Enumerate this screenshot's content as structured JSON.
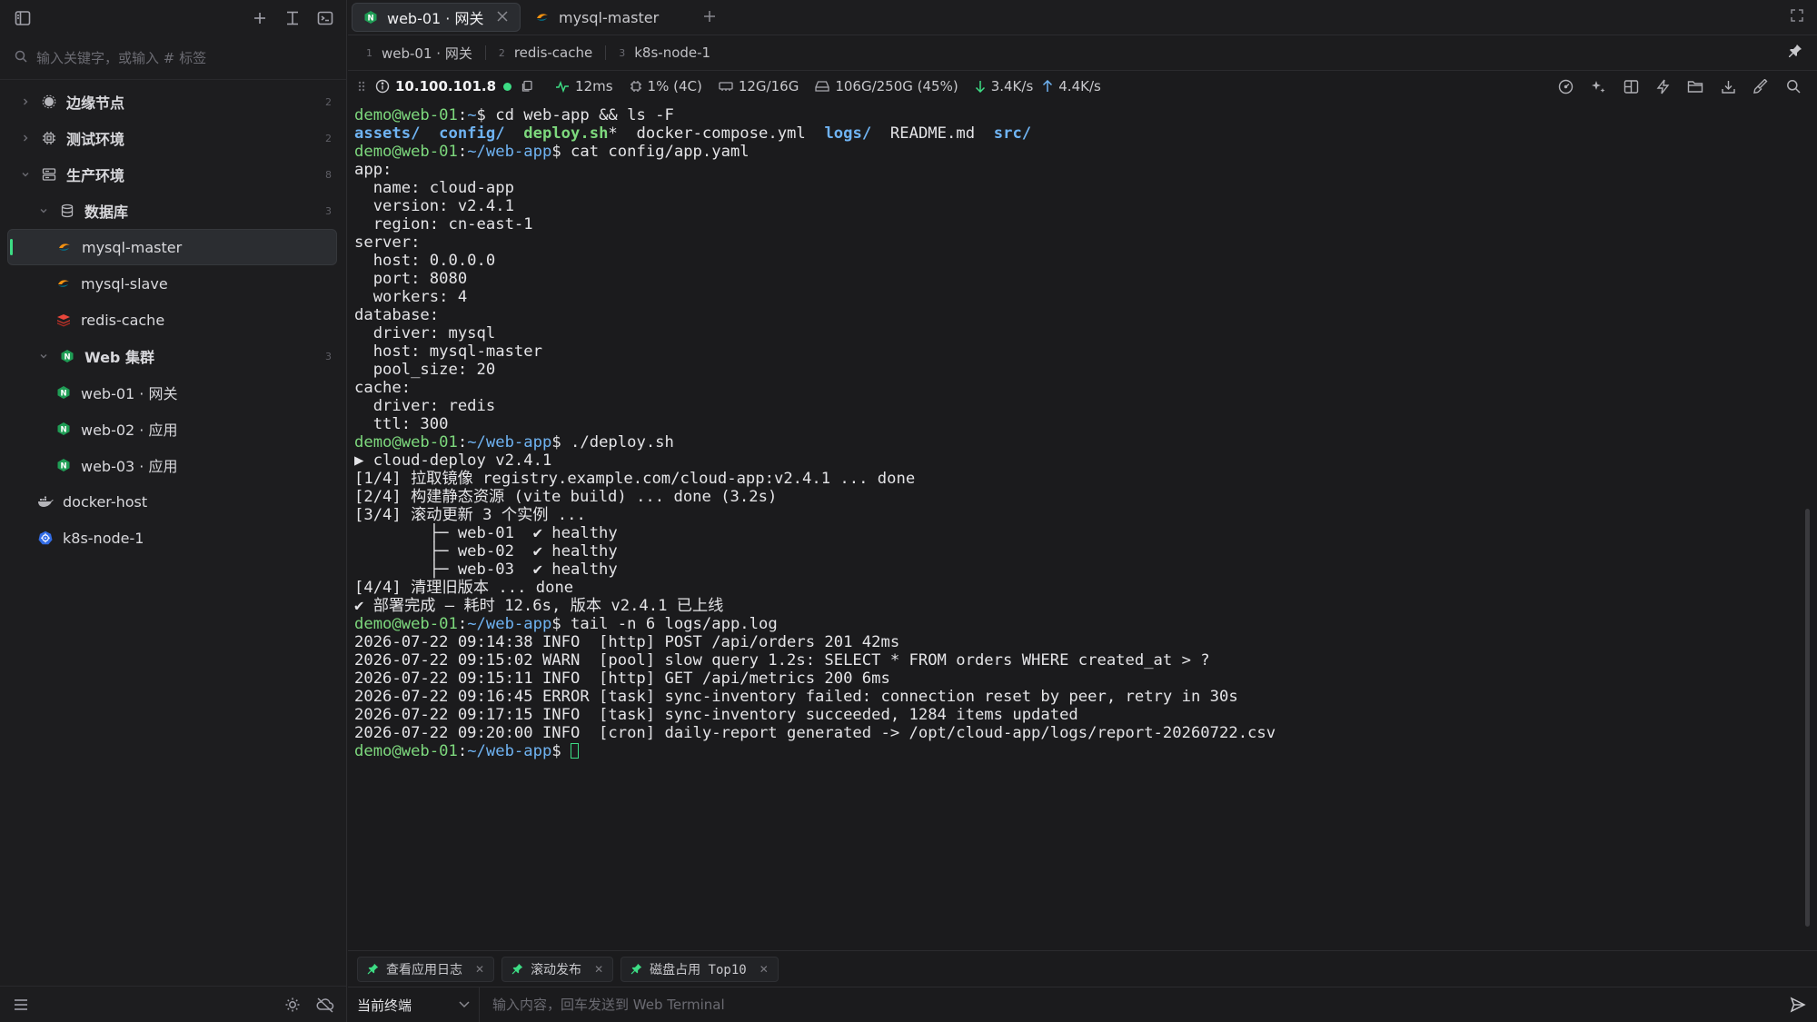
{
  "sidebar": {
    "search_placeholder": "输入关键字，或输入 # 标签",
    "tree": [
      {
        "label": "边缘节点",
        "count": "2",
        "level": 0,
        "expanded": false,
        "icon": "gear-dot-icon"
      },
      {
        "label": "测试环境",
        "count": "2",
        "level": 0,
        "expanded": false,
        "icon": "chip-icon"
      },
      {
        "label": "生产环境",
        "count": "8",
        "level": 0,
        "expanded": true,
        "icon": "server-icon"
      },
      {
        "label": "数据库",
        "count": "3",
        "level": 1,
        "expanded": true,
        "icon": "database-icon"
      },
      {
        "label": "mysql-master",
        "level": 2,
        "selected": true,
        "icon": "mysql-icon"
      },
      {
        "label": "mysql-slave",
        "level": 2,
        "icon": "mysql-icon"
      },
      {
        "label": "redis-cache",
        "level": 2,
        "icon": "redis-icon"
      },
      {
        "label": "Web 集群",
        "count": "3",
        "level": 1,
        "expanded": true,
        "icon": "nginx-icon"
      },
      {
        "label": "web-01 · 网关",
        "level": 2,
        "icon": "nginx-icon"
      },
      {
        "label": "web-02 · 应用",
        "level": 2,
        "icon": "nginx-icon"
      },
      {
        "label": "web-03 · 应用",
        "level": 2,
        "icon": "nginx-icon"
      },
      {
        "label": "docker-host",
        "level": 1,
        "icon": "docker-icon"
      },
      {
        "label": "k8s-node-1",
        "level": 1,
        "icon": "kubernetes-icon"
      }
    ]
  },
  "tabs": [
    {
      "label": "web-01 · 网关",
      "active": true,
      "icon": "nginx-icon"
    },
    {
      "label": "mysql-master",
      "active": false,
      "icon": "mysql-icon"
    }
  ],
  "subtabs": [
    {
      "num": "1",
      "label": "web-01 · 网关"
    },
    {
      "num": "2",
      "label": "redis-cache"
    },
    {
      "num": "3",
      "label": "k8s-node-1"
    }
  ],
  "status": {
    "ip": "10.100.101.8",
    "latency": "12ms",
    "cpu": "1% (4C)",
    "memory": "12G/16G",
    "disk": "106G/250G (45%)",
    "download": "3.4K/s",
    "upload": "4.4K/s"
  },
  "terminal": {
    "prompt_user": "demo@web-01",
    "lines": [
      {
        "type": "cmd",
        "path": "~",
        "text": "cd web-app && ls -F"
      },
      {
        "type": "ls",
        "items": [
          {
            "t": "assets/",
            "k": "dir"
          },
          {
            "t": "config/",
            "k": "dir"
          },
          {
            "t": "deploy.sh",
            "k": "exe"
          },
          {
            "t": "*",
            "k": "plain"
          },
          {
            "t": "docker-compose.yml",
            "k": "plain"
          },
          {
            "t": "logs/",
            "k": "dir"
          },
          {
            "t": "README.md",
            "k": "plain"
          },
          {
            "t": "src/",
            "k": "dir"
          }
        ]
      },
      {
        "type": "cmd",
        "path": "~/web-app",
        "text": "cat config/app.yaml"
      },
      {
        "type": "out",
        "text": "app:"
      },
      {
        "type": "out",
        "text": "  name: cloud-app"
      },
      {
        "type": "out",
        "text": "  version: v2.4.1"
      },
      {
        "type": "out",
        "text": "  region: cn-east-1"
      },
      {
        "type": "out",
        "text": "server:"
      },
      {
        "type": "out",
        "text": "  host: 0.0.0.0"
      },
      {
        "type": "out",
        "text": "  port: 8080"
      },
      {
        "type": "out",
        "text": "  workers: 4"
      },
      {
        "type": "out",
        "text": "database:"
      },
      {
        "type": "out",
        "text": "  driver: mysql"
      },
      {
        "type": "out",
        "text": "  host: mysql-master"
      },
      {
        "type": "out",
        "text": "  pool_size: 20"
      },
      {
        "type": "out",
        "text": "cache:"
      },
      {
        "type": "out",
        "text": "  driver: redis"
      },
      {
        "type": "out",
        "text": "  ttl: 300"
      },
      {
        "type": "cmd",
        "path": "~/web-app",
        "text": "./deploy.sh"
      },
      {
        "type": "out",
        "text": "▶ cloud-deploy v2.4.1"
      },
      {
        "type": "out",
        "text": "[1/4] 拉取镜像 registry.example.com/cloud-app:v2.4.1 ... done"
      },
      {
        "type": "out",
        "text": "[2/4] 构建静态资源 (vite build) ... done (3.2s)"
      },
      {
        "type": "out",
        "text": "[3/4] 滚动更新 3 个实例 ..."
      },
      {
        "type": "out",
        "text": "        ├─ web-01  ✔ healthy"
      },
      {
        "type": "out",
        "text": "        ├─ web-02  ✔ healthy"
      },
      {
        "type": "out",
        "text": "        ├─ web-03  ✔ healthy"
      },
      {
        "type": "out",
        "text": "[4/4] 清理旧版本 ... done"
      },
      {
        "type": "out",
        "text": "✔ 部署完成 — 耗时 12.6s, 版本 v2.4.1 已上线"
      },
      {
        "type": "cmd",
        "path": "~/web-app",
        "text": "tail -n 6 logs/app.log"
      },
      {
        "type": "out",
        "text": "2026-07-22 09:14:38 INFO  [http] POST /api/orders 201 42ms"
      },
      {
        "type": "out",
        "text": "2026-07-22 09:15:02 WARN  [pool] slow query 1.2s: SELECT * FROM orders WHERE created_at > ?"
      },
      {
        "type": "out",
        "text": "2026-07-22 09:15:11 INFO  [http] GET /api/metrics 200 6ms"
      },
      {
        "type": "out",
        "text": "2026-07-22 09:16:45 ERROR [task] sync-inventory failed: connection reset by peer, retry in 30s"
      },
      {
        "type": "out",
        "text": "2026-07-22 09:17:15 INFO  [task] sync-inventory succeeded, 1284 items updated"
      },
      {
        "type": "out",
        "text": "2026-07-22 09:20:00 INFO  [cron] daily-report generated -> /opt/cloud-app/logs/report-20260722.csv"
      },
      {
        "type": "prompt",
        "path": "~/web-app"
      }
    ]
  },
  "quick_commands": [
    {
      "label": "查看应用日志",
      "mono": false
    },
    {
      "label": "滚动发布",
      "mono": false
    },
    {
      "label": "磁盘占用 Top10",
      "mono": true
    }
  ],
  "input_bar": {
    "target_label": "当前终端",
    "placeholder": "输入内容，回车发送到 Web Terminal"
  },
  "colors": {
    "accent": "#3ddc84",
    "prompt_user": "#7dd87d",
    "prompt_path": "#6fb3f2",
    "background": "#1b1b1d"
  }
}
